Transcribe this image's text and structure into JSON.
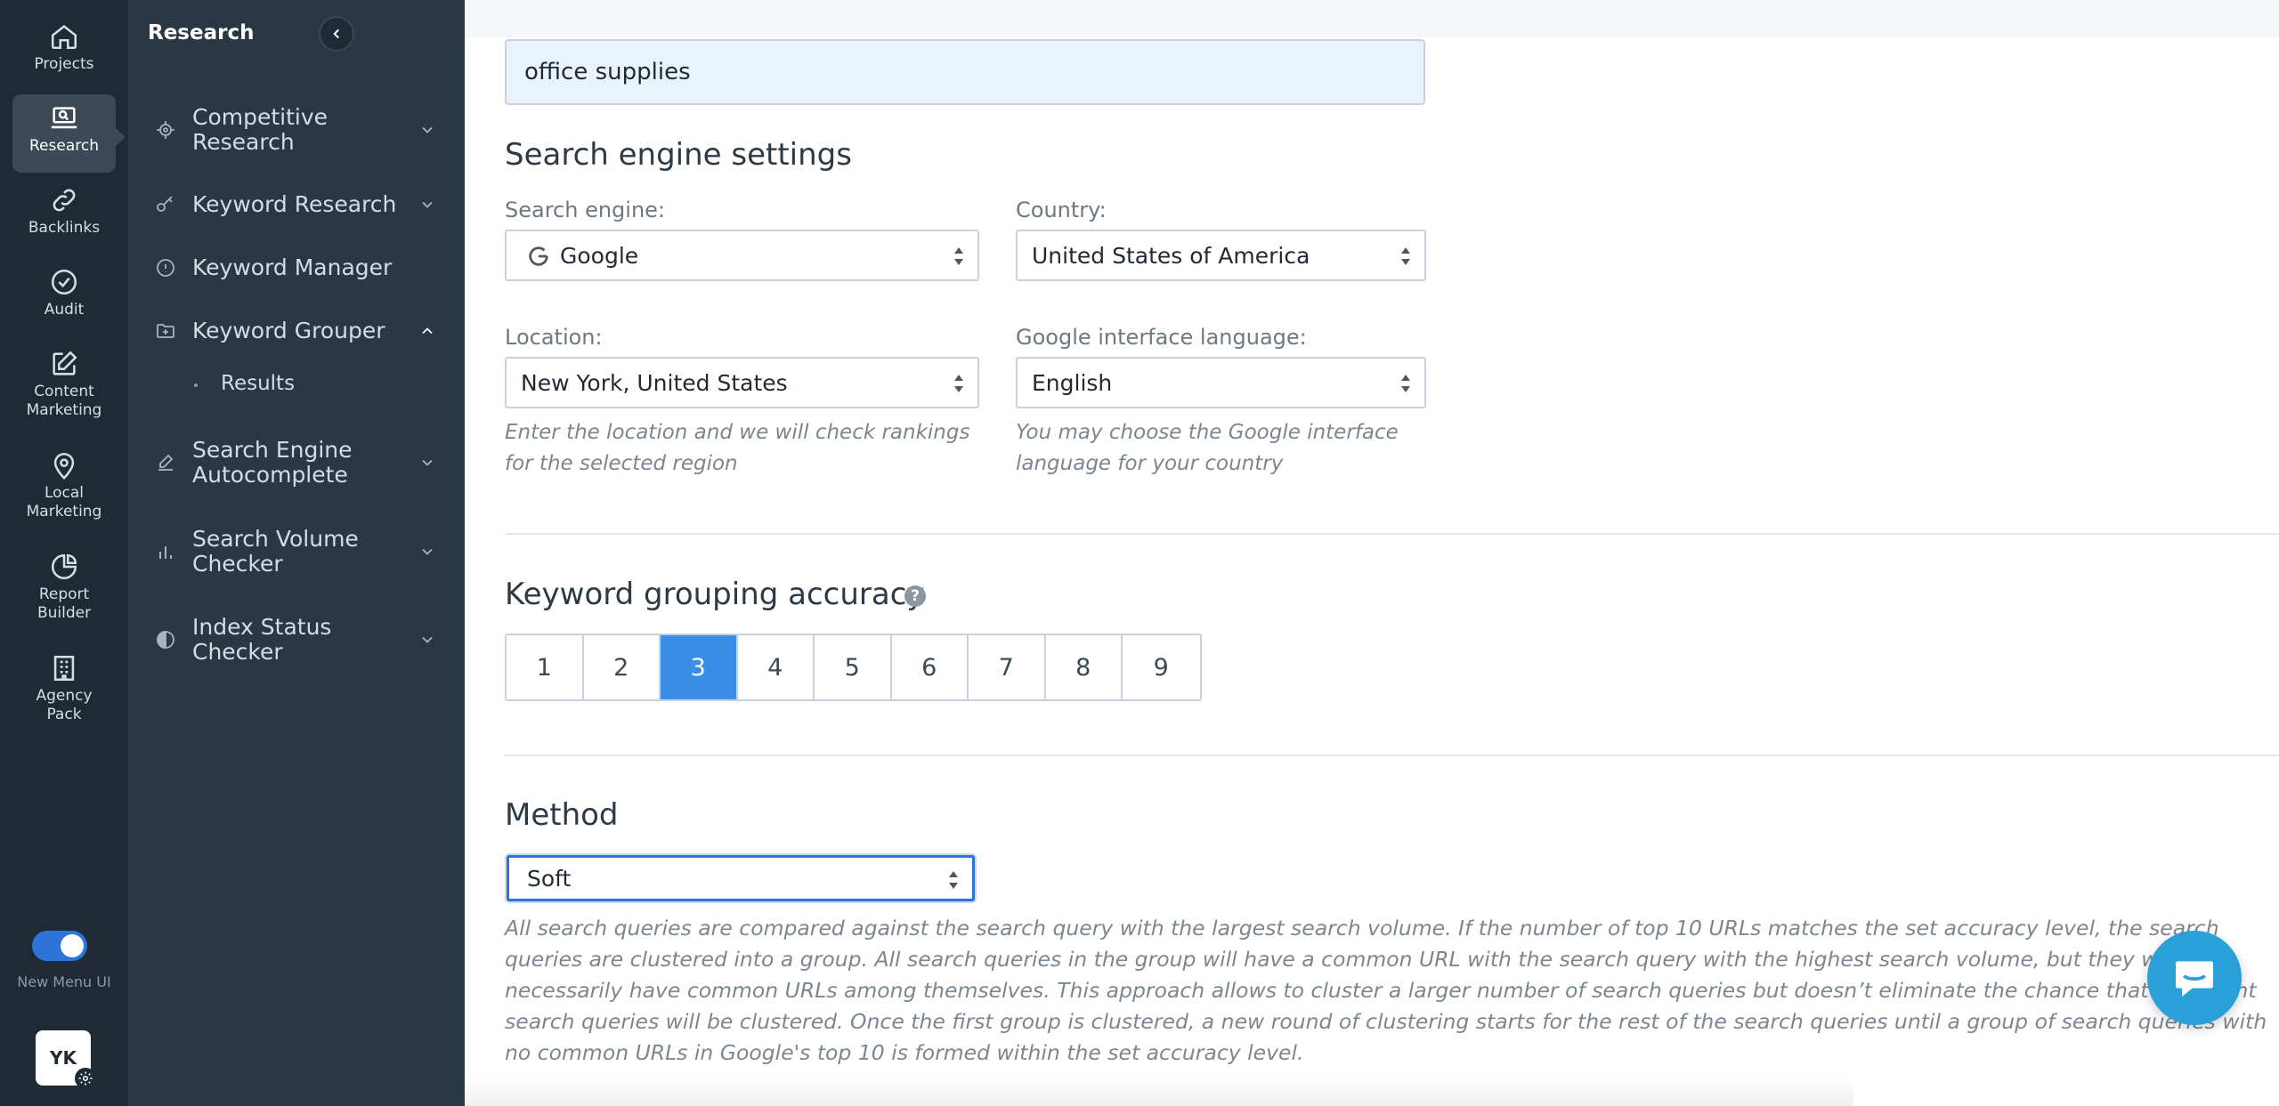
{
  "rail": {
    "items": [
      {
        "label": "Projects",
        "icon": "home-icon"
      },
      {
        "label": "Research",
        "icon": "laptop-search-icon"
      },
      {
        "label": "Backlinks",
        "icon": "link-icon"
      },
      {
        "label": "Audit",
        "icon": "check-circle-icon"
      },
      {
        "label": "Content Marketing",
        "icon": "edit-icon"
      },
      {
        "label": "Local Marketing",
        "icon": "map-pin-icon"
      },
      {
        "label": "Report Builder",
        "icon": "pie-chart-icon"
      },
      {
        "label": "Agency Pack",
        "icon": "building-icon"
      }
    ],
    "toggle_label": "New Menu UI",
    "avatar_initials": "YK"
  },
  "menu": {
    "title": "Research",
    "items": [
      {
        "label": "Competitive Research",
        "icon": "target-icon"
      },
      {
        "label": "Keyword Research",
        "icon": "key-icon"
      },
      {
        "label": "Keyword Manager",
        "icon": "info-circle-icon"
      },
      {
        "label": "Keyword Grouper",
        "icon": "folder-plus-icon"
      },
      {
        "label": "Search Engine Autocomplete",
        "icon": "pencil-icon"
      },
      {
        "label": "Search Volume Checker",
        "icon": "bar-chart-icon"
      },
      {
        "label": "Index Status Checker",
        "icon": "half-circle-icon"
      }
    ],
    "subitem": "Results"
  },
  "keyword_input": {
    "value": "office supplies"
  },
  "search_engine_settings": {
    "heading": "Search engine settings",
    "search_engine_label": "Search engine:",
    "search_engine_value": "Google",
    "country_label": "Country:",
    "country_value": "United States of America",
    "location_label": "Location:",
    "location_value": "New York, United States",
    "location_hint": "Enter the location and we will check rankings for the selected region",
    "language_label": "Google interface language:",
    "language_value": "English",
    "language_hint": "You may choose the Google interface language for your country"
  },
  "accuracy": {
    "heading": "Keyword grouping accuracy",
    "options": [
      "1",
      "2",
      "3",
      "4",
      "5",
      "6",
      "7",
      "8",
      "9"
    ],
    "selected": "3"
  },
  "method": {
    "heading": "Method",
    "value": "Soft",
    "description": "All search queries are compared against the search query with the largest search volume. If the number of top 10 URLs matches the set accuracy level, the search queries are clustered into a group. All search queries in the group will have a common URL with the search query with the highest search volume, but they won’t necessarily have common URLs among themselves. This approach allows to cluster a larger number of search queries but doesn’t eliminate the chance that irrelevant search queries will be clustered. Once the first group is clustered, a new round of clustering starts for the rest of the search queries until a group of search queries with no common URLs in Google's top 10 is formed within the set accuracy level."
  },
  "colors": {
    "accent": "#3a8ee6",
    "rail_bg": "#1f2a35",
    "menu_bg": "#2a3846",
    "chat": "#2a9fd8"
  }
}
